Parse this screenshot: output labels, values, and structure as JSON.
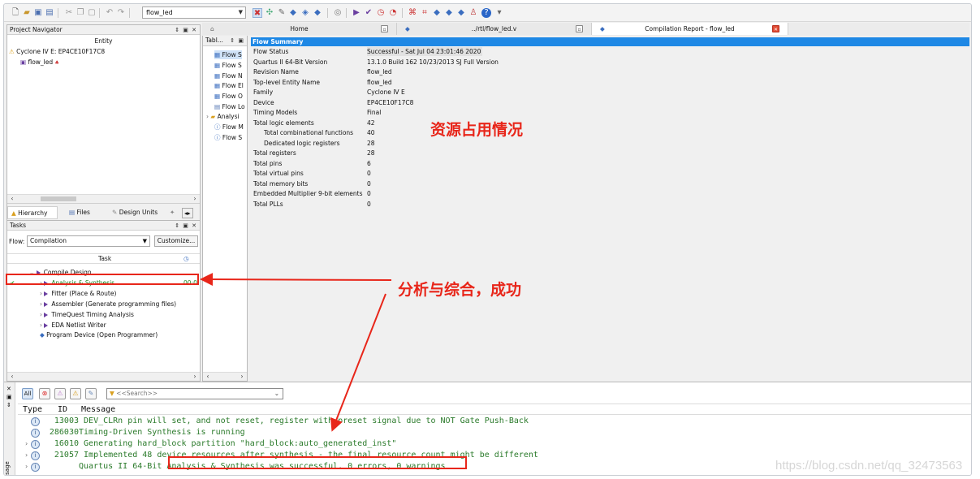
{
  "toolbar": {
    "project_combo": "flow_led"
  },
  "project_navigator": {
    "title": "Project Navigator",
    "column_entity": "Entity",
    "device_row": "Cyclone IV E: EP4CE10F17C8",
    "top_entity": "flow_led",
    "tabs": [
      "Hierarchy",
      "Files",
      "Design Units"
    ]
  },
  "tasks": {
    "title": "Tasks",
    "flow_label": "Flow:",
    "flow_value": "Compilation",
    "customize_label": "Customize...",
    "column_task": "Task",
    "items": [
      {
        "label": "Compile Design",
        "time": ""
      },
      {
        "label": "Analysis & Synthesis",
        "time": "00:0"
      },
      {
        "label": "Fitter (Place & Route)",
        "time": ""
      },
      {
        "label": "Assembler (Generate programming files)",
        "time": ""
      },
      {
        "label": "TimeQuest Timing Analysis",
        "time": ""
      },
      {
        "label": "EDA Netlist Writer",
        "time": ""
      },
      {
        "label": "Program Device (Open Programmer)",
        "time": ""
      }
    ]
  },
  "toc": {
    "title": "Tabl...",
    "items": [
      "Flow S",
      "Flow S",
      "Flow N",
      "Flow El",
      "Flow O",
      "Flow Lo",
      "Analysi",
      "Flow M",
      "Flow S"
    ]
  },
  "doc_tabs": {
    "home": "Home",
    "file": "../rtl/flow_led.v",
    "report": "Compilation Report - flow_led"
  },
  "flow_summary": {
    "title": "Flow Summary",
    "rows": [
      {
        "key": "Flow Status",
        "value": "Successful - Sat Jul 04 23:01:46 2020"
      },
      {
        "key": "Quartus II 64-Bit Version",
        "value": "13.1.0 Build 162 10/23/2013 SJ Full Version"
      },
      {
        "key": "Revision Name",
        "value": "flow_led"
      },
      {
        "key": "Top-level Entity Name",
        "value": "flow_led"
      },
      {
        "key": "Family",
        "value": "Cyclone IV E"
      },
      {
        "key": "Device",
        "value": "EP4CE10F17C8"
      },
      {
        "key": "Timing Models",
        "value": "Final"
      },
      {
        "key": "Total logic elements",
        "value": "42"
      },
      {
        "key": "Total combinational functions",
        "value": "40"
      },
      {
        "key": "Dedicated logic registers",
        "value": "28"
      },
      {
        "key": "Total registers",
        "value": "28"
      },
      {
        "key": "Total pins",
        "value": "6"
      },
      {
        "key": "Total virtual pins",
        "value": "0"
      },
      {
        "key": "Total memory bits",
        "value": "0"
      },
      {
        "key": "Embedded Multiplier 9-bit elements",
        "value": "0"
      },
      {
        "key": "Total PLLs",
        "value": "0"
      }
    ]
  },
  "annotations": {
    "resource_usage": "资源占用情况",
    "synthesis_success": "分析与综合，成功"
  },
  "messages": {
    "filter_all": "All",
    "search_placeholder": "<<Search>>",
    "columns": {
      "type": "Type",
      "id": "ID",
      "message": "Message"
    },
    "items": [
      {
        "id": "13003",
        "text": "DEV_CLRn pin will set, and not reset, register with preset signal due to NOT Gate Push-Back"
      },
      {
        "id": "286030",
        "text": "Timing-Driven Synthesis is running"
      },
      {
        "id": "16010",
        "text": "Generating hard_block partition \"hard_block:auto_generated_inst\""
      },
      {
        "id": "21057",
        "text": "Implemented 48 device resources after synthesis - the final resource count might be different"
      },
      {
        "id": "",
        "prefix": "Quartus II 64-Bit",
        "text": "Analysis & Synthesis was successful. 0 errors, 0 warnings"
      }
    ],
    "side_label": "sage"
  },
  "watermark": "https://blog.csdn.net/qq_32473563",
  "colors": {
    "accent_blue": "#1e88e5",
    "annotation_red": "#e8261a",
    "message_green": "#2a7a2a"
  }
}
